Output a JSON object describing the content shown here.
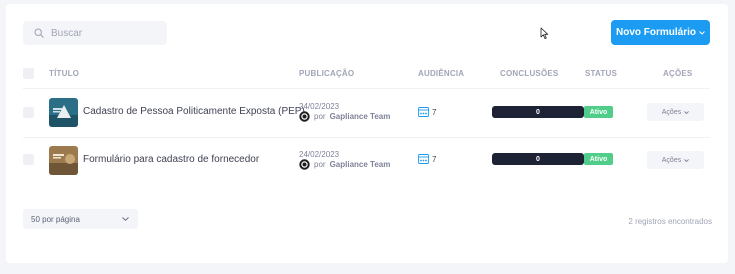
{
  "search": {
    "placeholder": "Buscar",
    "icon": "search-icon"
  },
  "toolbar": {
    "new_form_label": "Novo Formulário"
  },
  "table": {
    "columns": {
      "title": "TÍTULO",
      "published": "PUBLICAÇÃO",
      "audience": "AUDIÊNCIA",
      "completions": "CONCLUSÕES",
      "status": "STATUS",
      "actions": "AÇÕES"
    },
    "rows": [
      {
        "title": "Cadastro de Pessoa Politicamente Exposta (PEP)",
        "date": "24/02/2023",
        "by_prefix": "por",
        "author": "Gapliance Team",
        "audience": "7",
        "completions": "0",
        "status": "Ativo",
        "actions_label": "Ações"
      },
      {
        "title": "Formulário para cadastro de fornecedor",
        "date": "24/02/2023",
        "by_prefix": "por",
        "author": "Gapliance Team",
        "audience": "7",
        "completions": "0",
        "status": "Ativo",
        "actions_label": "Ações"
      }
    ]
  },
  "footer": {
    "page_size_label": "50 por página",
    "records_count": "2 registros encontrados"
  },
  "colors": {
    "primary": "#1b9cf2",
    "status_active": "#50cd89",
    "completion_bar": "#1e2235",
    "background": "#f3f5f8"
  }
}
